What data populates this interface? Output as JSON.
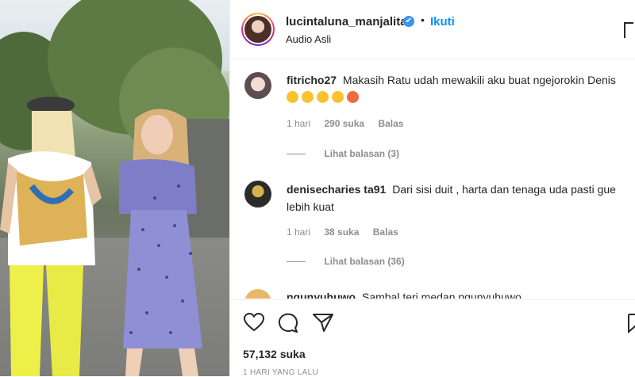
{
  "post": {
    "username": "lucintaluna_manjalita",
    "verified_mark": "✔",
    "separator": "•",
    "follow_label": "Ikuti",
    "audio_label": "Audio Asli"
  },
  "comments": [
    {
      "username": "fitricho27",
      "text": "Makasih Ratu udah mewakili aku buat ngejorokin Denis",
      "emojis": [
        "laughing-emoji",
        "laughing-emoji",
        "laughing-emoji",
        "laughing-emoji",
        "angry-emoji"
      ],
      "time": "1 hari",
      "likes": "290 suka",
      "reply_label": "Balas",
      "view_replies": "Lihat balasan (3)"
    },
    {
      "username": "denisecharies ta91",
      "text": "Dari sisi duit , harta dan tenaga uda pasti gue lebih kuat",
      "time": "1 hari",
      "likes": "38 suka",
      "reply_label": "Balas",
      "view_replies": "Lihat balasan (36)"
    },
    {
      "username": "ngunyuhuwo",
      "text": "Sambal teri medan ngunyuhuwo..."
    }
  ],
  "footer": {
    "likes": "57,132 suka",
    "timestamp": "1 HARI YANG LALU"
  },
  "icons": {
    "like": "heart-icon",
    "comment": "comment-icon",
    "share": "send-icon",
    "save": "bookmark-icon"
  }
}
